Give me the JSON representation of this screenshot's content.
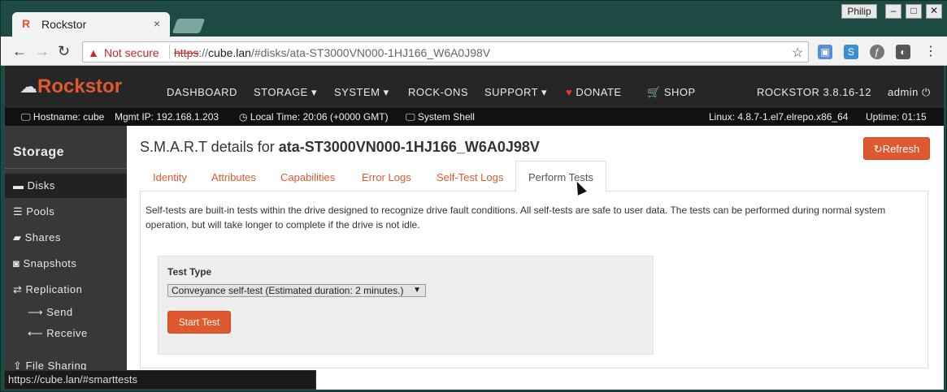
{
  "browser": {
    "tab_title": "Rockstor",
    "tab_favicon": "R",
    "tab_close": "×",
    "user_name": "Philip",
    "security_label": "Not secure",
    "url_scheme": "https",
    "url_host": "cube.lan",
    "url_path": "/#disks/ata-ST3000VN000-1HJ166_W6A0J98V",
    "status_url": "https://cube.lan/#smarttests"
  },
  "navbar": {
    "brand": "Rockstor",
    "items": [
      "DASHBOARD",
      "STORAGE ▾",
      "SYSTEM ▾",
      "ROCK-ONS",
      "SUPPORT ▾"
    ],
    "donate": "DONATE",
    "shop": "SHOP",
    "version": "ROCKSTOR 3.8.16-12",
    "user": "admin"
  },
  "infobar": {
    "hostname": "Hostname: cube",
    "mgmt_ip": "Mgmt IP: 192.168.1.203",
    "local_time": "Local Time: 20:06 (+0000 GMT)",
    "system_shell": "System Shell",
    "linux": "Linux: 4.8.7-1.el7.elrepo.x86_64",
    "uptime": "Uptime: 01:15"
  },
  "sidebar": {
    "title": "Storage",
    "items": [
      "Disks",
      "Pools",
      "Shares",
      "Snapshots",
      "Replication"
    ],
    "sub_items": [
      "Send",
      "Receive"
    ],
    "file_sharing": "File Sharing"
  },
  "page": {
    "title_prefix": "S.M.A.R.T details for ",
    "title_disk": "ata-ST3000VN000-1HJ166_W6A0J98V",
    "refresh_label": "Refresh",
    "tabs": [
      "Identity",
      "Attributes",
      "Capabilities",
      "Error Logs",
      "Self-Test Logs",
      "Perform Tests"
    ],
    "description": "Self-tests are built-in tests within the drive designed to recognize drive fault conditions. All self-tests are safe to user data. The tests can be performed during normal system operation, but will take longer to complete if the drive is not idle.",
    "test_type_label": "Test Type",
    "test_type_value": "Conveyance self-test (Estimated duration: 2 minutes.)",
    "start_label": "Start Test"
  },
  "colors": {
    "accent": "#e0592e",
    "navbar_bg": "#262626",
    "sidebar_bg": "#383838"
  }
}
